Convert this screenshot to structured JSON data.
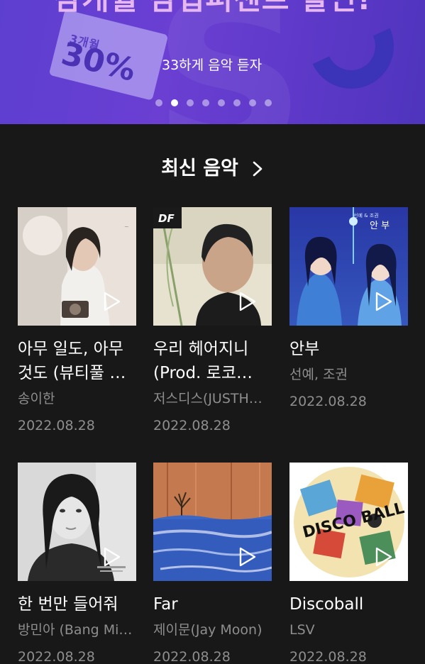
{
  "banner": {
    "headline": "삼개월 삼십퍼센트 할인!",
    "subline": "33하게 음악 듣자",
    "ticket_top": "3개월",
    "ticket_pct": "30%",
    "dot_count": 8,
    "active_dot": 1,
    "colors": {
      "bg": "#5d3fd0",
      "accent": "#e7b8ef"
    }
  },
  "section": {
    "title": "최신 음악",
    "more_icon": "chevron-right-icon"
  },
  "albums": [
    {
      "title_line1": "아무 일도, 아무",
      "title_line2": "것도 (뷰티풀 …",
      "artist": "송이한",
      "date": "2022.08.28"
    },
    {
      "title_line1": "우리 헤어지니",
      "title_line2": "(Prod. 로코…",
      "artist": "저스디스(JUSTH…",
      "date": "2022.08.28",
      "cover_badge": "DF"
    },
    {
      "title_line1": "안부",
      "title_line2": "",
      "artist": "선예, 조권",
      "date": "2022.08.28",
      "cover_text": "안 부",
      "cover_small": "선예 & 조권"
    },
    {
      "title_line1": "한 번만 들어줘",
      "title_line2": "",
      "artist": "방민아 (Bang Mi…",
      "date": "2022.08.28"
    },
    {
      "title_line1": "Far",
      "title_line2": "",
      "artist": "제이문(Jay Moon)",
      "date": "2022.08.28"
    },
    {
      "title_line1": "Discoball",
      "title_line2": "",
      "artist": "LSV",
      "date": "2022.08.28",
      "cover_text": "DISCO BALL"
    }
  ]
}
